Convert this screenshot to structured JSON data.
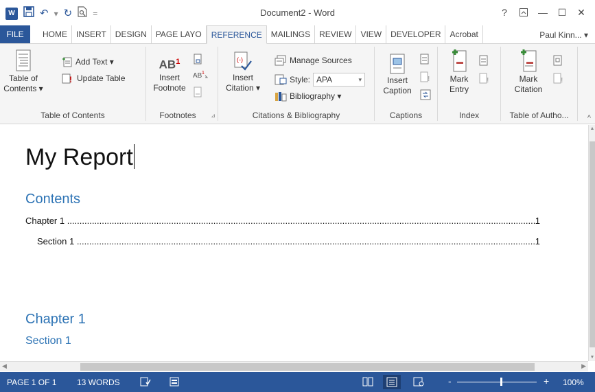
{
  "titlebar": {
    "app_badge": "W",
    "document_title": "Document2 - Word",
    "qat": {
      "save": "🖫",
      "undo": "↶",
      "undo_drop": "▾",
      "redo": "↻",
      "print_preview": "⎘",
      "customize": "₹"
    },
    "window": {
      "help": "?",
      "ribbon_opts": "⊼",
      "minimize": "—",
      "restore": "☐",
      "close": "✕"
    }
  },
  "tabs": [
    {
      "label": "FILE"
    },
    {
      "label": "HOME"
    },
    {
      "label": "INSERT"
    },
    {
      "label": "DESIGN"
    },
    {
      "label": "PAGE LAYO"
    },
    {
      "label": "REFERENCE"
    },
    {
      "label": "MAILINGS"
    },
    {
      "label": "REVIEW"
    },
    {
      "label": "VIEW"
    },
    {
      "label": "DEVELOPER"
    },
    {
      "label": "Acrobat"
    }
  ],
  "user": "Paul Kinn... ▾",
  "ribbon": {
    "toc_group": {
      "label": "Table of Contents",
      "toc_btn_line1": "Table of",
      "toc_btn_line2": "Contents ▾",
      "add_text": "Add Text ▾",
      "update_table": "Update Table"
    },
    "footnotes_group": {
      "label": "Footnotes",
      "insert_line1": "Insert",
      "insert_line2": "Footnote",
      "ab_text": "AB",
      "sup": "1",
      "launcher": "⊿"
    },
    "citations_group": {
      "label": "Citations & Bibliography",
      "insert_line1": "Insert",
      "insert_line2": "Citation ▾",
      "manage_sources": "Manage Sources",
      "style_label": "Style:",
      "style_value": "APA",
      "bibliography": "Bibliography ▾"
    },
    "captions_group": {
      "label": "Captions",
      "insert_line1": "Insert",
      "insert_line2": "Caption"
    },
    "index_group": {
      "label": "Index",
      "mark_line1": "Mark",
      "mark_line2": "Entry"
    },
    "toa_group": {
      "label": "Table of Autho...",
      "mark_line1": "Mark",
      "mark_line2": "Citation"
    },
    "collapse": "^"
  },
  "document": {
    "title": "My Report",
    "toc_heading": "Contents",
    "toc_entries": [
      {
        "text": "Chapter 1",
        "page": "1"
      },
      {
        "text": "Section 1",
        "page": "1"
      }
    ],
    "heading1": "Chapter 1",
    "heading2": "Section 1"
  },
  "statusbar": {
    "page": "PAGE 1 OF 1",
    "words": "13 WORDS",
    "zoom": "100%",
    "zoom_minus": "-",
    "zoom_plus": "+",
    "zoom_level": 1.0
  },
  "colors": {
    "brand": "#2b579a",
    "heading": "#2e74b5"
  }
}
